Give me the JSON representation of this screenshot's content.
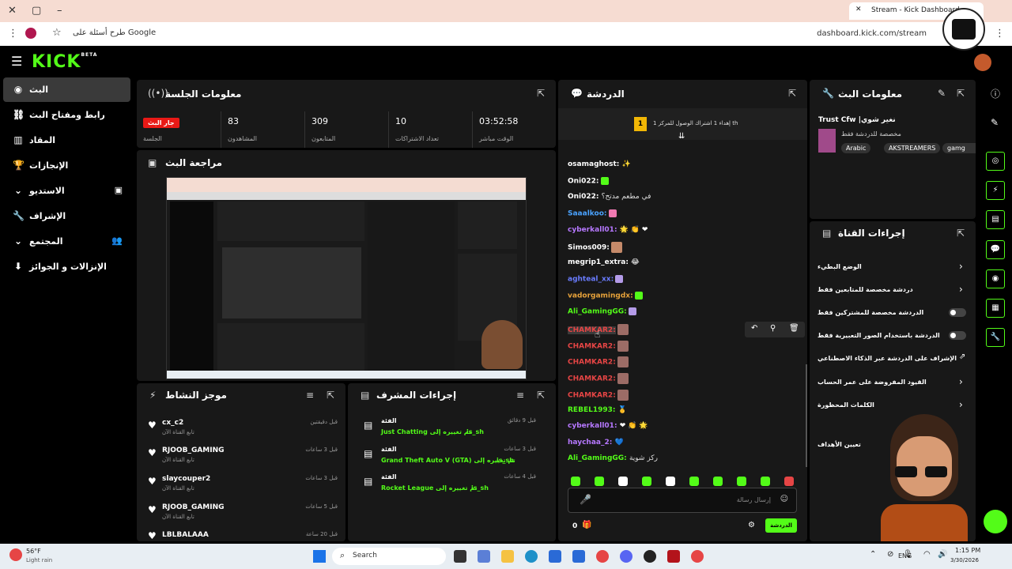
{
  "browser": {
    "tab_title": "Stream - Kick Dashboard",
    "url": "dashboard.kick.com/stream",
    "omnibox_hint": "طرح أسئلة على Google"
  },
  "header": {
    "logo": "KICK",
    "beta": "BETA"
  },
  "sidebar": {
    "items": [
      {
        "label": "البث"
      },
      {
        "label": "رابط ومفتاح البث"
      },
      {
        "label": "المقاد"
      },
      {
        "label": "الإنجازات"
      },
      {
        "label": "الاستديو"
      },
      {
        "label": "الإشراف"
      },
      {
        "label": "المجتمع"
      },
      {
        "label": "الإنزالات و الجوائز"
      }
    ]
  },
  "session": {
    "title": "معلومات الجلسة",
    "stats": [
      {
        "value": "جار البث",
        "label": "الجلسة"
      },
      {
        "value": "83",
        "label": "المشاهدون"
      },
      {
        "value": "309",
        "label": "المتابعون"
      },
      {
        "value": "10",
        "label": "تعداد الاشتراكات"
      },
      {
        "value": "03:52:58",
        "label": "الوقت مباشر"
      }
    ]
  },
  "preview": {
    "title": "مراجعة البث"
  },
  "chat": {
    "title": "الدردشة",
    "banner": "إهداء 1 اشتراك الوصول للمركز 1 th",
    "banner_badge": "1",
    "messages": [
      {
        "user": "osamaghost:",
        "text": "✨",
        "color": "#ffffff"
      },
      {
        "user": "Oni022:",
        "text": "",
        "color": "#ffffff"
      },
      {
        "user": "Oni022:",
        "text": "في مطعم مدتح؟",
        "color": "#ffffff"
      },
      {
        "user": "Saaalkoo:",
        "text": "",
        "color": "#4aa3ff"
      },
      {
        "user": "cyberkall01:",
        "text": "🌟 👏 ❤",
        "color": "#b678ff"
      },
      {
        "user": "Simos009:",
        "text": "",
        "color": "#ffffff"
      },
      {
        "user": "megrip1_extra:",
        "text": "😂",
        "color": "#ffffff"
      },
      {
        "user": "aghteal_xx:",
        "text": "",
        "color": "#6a7cff"
      },
      {
        "user": "vadorgamingdx:",
        "text": "",
        "color": "#e7a23a"
      },
      {
        "user": "Ali_GamingGG:",
        "text": "",
        "color": "#53fc18"
      },
      {
        "user": "CHAMKAR2:",
        "text": "",
        "color": "#e64545"
      },
      {
        "user": "CHAMKAR2:",
        "text": "",
        "color": "#e64545"
      },
      {
        "user": "CHAMKAR2:",
        "text": "",
        "color": "#e64545"
      },
      {
        "user": "CHAMKAR2:",
        "text": "",
        "color": "#e64545"
      },
      {
        "user": "CHAMKAR2:",
        "text": "",
        "color": "#e64545"
      },
      {
        "user": "REBEL1993:",
        "text": "🥇",
        "color": "#53fc18"
      },
      {
        "user": "cyberkall01:",
        "text": "❤ 👏 🌟",
        "color": "#b678ff"
      },
      {
        "user": "haychaa_2:",
        "text": "💙",
        "color": "#b678ff"
      },
      {
        "user": "Ali_GamingGG:",
        "text": "ركز شوية",
        "color": "#53fc18"
      }
    ],
    "input_placeholder": "إرسال رسالة",
    "send_label": "الدردشة",
    "count": "0"
  },
  "stream_info": {
    "title": "معلومات البث",
    "stream_title": "Trust Cfw |نغير شوي",
    "subtitle": "مخصصة للدردشة فقط",
    "tags": [
      "Arabic",
      "AKSTREAMERS",
      "gamg"
    ]
  },
  "channel_actions": {
    "title": "إجراءات القناة",
    "rows": [
      {
        "label": "الوضع البطيء",
        "type": "chevron"
      },
      {
        "label": "دردشة مخصصة للمتابعين فقط",
        "type": "chevron"
      },
      {
        "label": "الدردشة مخصصة للمشتركين فقط",
        "type": "toggle"
      },
      {
        "label": "الدردشة باستخدام الصور التعبيرية فقط",
        "type": "toggle"
      },
      {
        "label": "الإشراف على الدردشة عبر الذكاء الاصطناعي",
        "type": "link"
      },
      {
        "label": "القيود المفروضة على عمر الحساب",
        "type": "chevron"
      },
      {
        "label": "الكلمات المحظورة",
        "type": "chevron"
      },
      {
        "label": "تعيين الأهداف",
        "type": "none"
      }
    ]
  },
  "activity": {
    "title": "موجز النشاط",
    "items": [
      {
        "name": "cx_c2",
        "sub": "تابع القناة الآن",
        "time": "قبل دقيقتين"
      },
      {
        "name": "RJOOB_GAMING",
        "sub": "تابع القناة الآن",
        "time": "قبل 3 ساعات"
      },
      {
        "name": "slaycouper2",
        "sub": "تابع القناة الآن",
        "time": "قبل 3 ساعات"
      },
      {
        "name": "RJOOB_GAMING",
        "sub": "تابع القناة الآن",
        "time": "قبل 5 ساعات"
      },
      {
        "name": "LBLBALAAA",
        "sub": "",
        "time": "قبل 20 ساعة"
      }
    ]
  },
  "mod_actions": {
    "title": "إجراءات المشرف",
    "items": [
      {
        "head": "الفئة",
        "desc": "Just Chatting تم تغييره إلى",
        "by": "is_sh",
        "time": "قبل 9 دقائق"
      },
      {
        "head": "الفئة",
        "desc": "Grand Theft Auto V (GTA) تم تغييره إلى",
        "by": "is_sh",
        "time": "قبل 3 ساعات"
      },
      {
        "head": "الفئة",
        "desc": "Rocket League تم تغييره إلى",
        "by": "is_sh",
        "time": "قبل 4 ساعات"
      }
    ]
  },
  "taskbar": {
    "weather_temp": "56°F",
    "weather_desc": "Light rain",
    "search": "Search",
    "lang": "ENG",
    "time": "1:15 PM",
    "date": "3/30/2026"
  },
  "colors": {
    "accent": "#53fc18",
    "panel": "#181818",
    "live": "#e91916"
  }
}
